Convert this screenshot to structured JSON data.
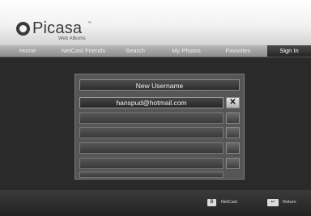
{
  "app": {
    "logo_text": "Picasa",
    "logo_tm": "™",
    "logo_subtitle": "Web Albums"
  },
  "nav": {
    "tabs": [
      {
        "label": "Home",
        "active": false
      },
      {
        "label": "NetCast Friends",
        "active": false
      },
      {
        "label": "Search",
        "active": false
      },
      {
        "label": "My Photos",
        "active": false
      },
      {
        "label": "Favorites",
        "active": false
      },
      {
        "label": "Sign In",
        "active": true
      }
    ]
  },
  "signin": {
    "new_username_label": "New Username",
    "saved_users": [
      "hanspud@hotmail.com",
      "",
      "",
      "",
      "",
      ""
    ],
    "delete_icon": "close-icon"
  },
  "footer": {
    "hints": [
      {
        "key": "B",
        "label": "NetCast",
        "icon": "netcast-key-icon"
      },
      {
        "key": "↩",
        "label": "Return",
        "icon": "return-key-icon"
      }
    ]
  },
  "colors": {
    "background": "#2a2a2a",
    "header": "#f2f2f2",
    "nav": "#a0a0a0",
    "active_tab": "#2f2f2f"
  }
}
